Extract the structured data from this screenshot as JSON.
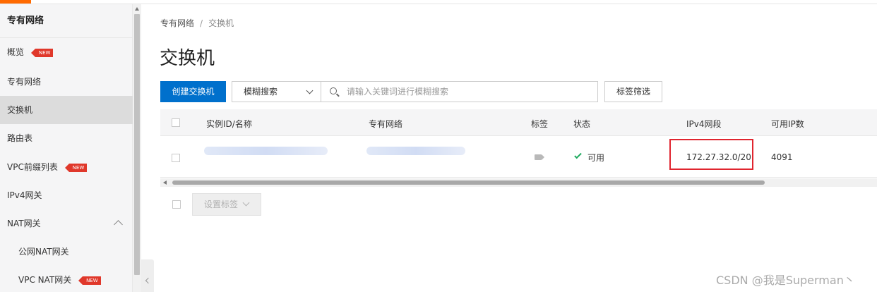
{
  "sidebar": {
    "title": "专有网络",
    "items": [
      {
        "label": "概览",
        "badge": "NEW"
      },
      {
        "label": "专有网络"
      },
      {
        "label": "交换机",
        "active": true
      },
      {
        "label": "路由表"
      },
      {
        "label": "VPC前缀列表",
        "badge": "NEW"
      },
      {
        "label": "IPv4网关"
      },
      {
        "label": "NAT网关"
      },
      {
        "label": "公网NAT网关"
      },
      {
        "label": "VPC NAT网关",
        "badge": "NEW"
      }
    ]
  },
  "breadcrumb": {
    "parent": "专有网络",
    "sep": "/",
    "current": "交换机"
  },
  "page_title": "交换机",
  "toolbar": {
    "create_label": "创建交换机",
    "select_value": "模糊搜索",
    "search_placeholder": "请输入关键词进行模糊搜索",
    "tag_filter_label": "标签筛选"
  },
  "table": {
    "columns": [
      "实例ID/名称",
      "专有网络",
      "标签",
      "状态",
      "IPv4网段",
      "可用IP数"
    ],
    "rows": [
      {
        "status": "可用",
        "ipv4": "172.27.32.0/20",
        "available_ips": "4091"
      }
    ]
  },
  "footer": {
    "set_tag_label": "设置标签"
  },
  "watermark": "CSDN @我是Superman丶",
  "colors": {
    "accent": "#ff6a00",
    "primary": "#0070cc",
    "badge": "#e0382b",
    "highlight": "#e0252f",
    "status_ok": "#1ba95c"
  }
}
